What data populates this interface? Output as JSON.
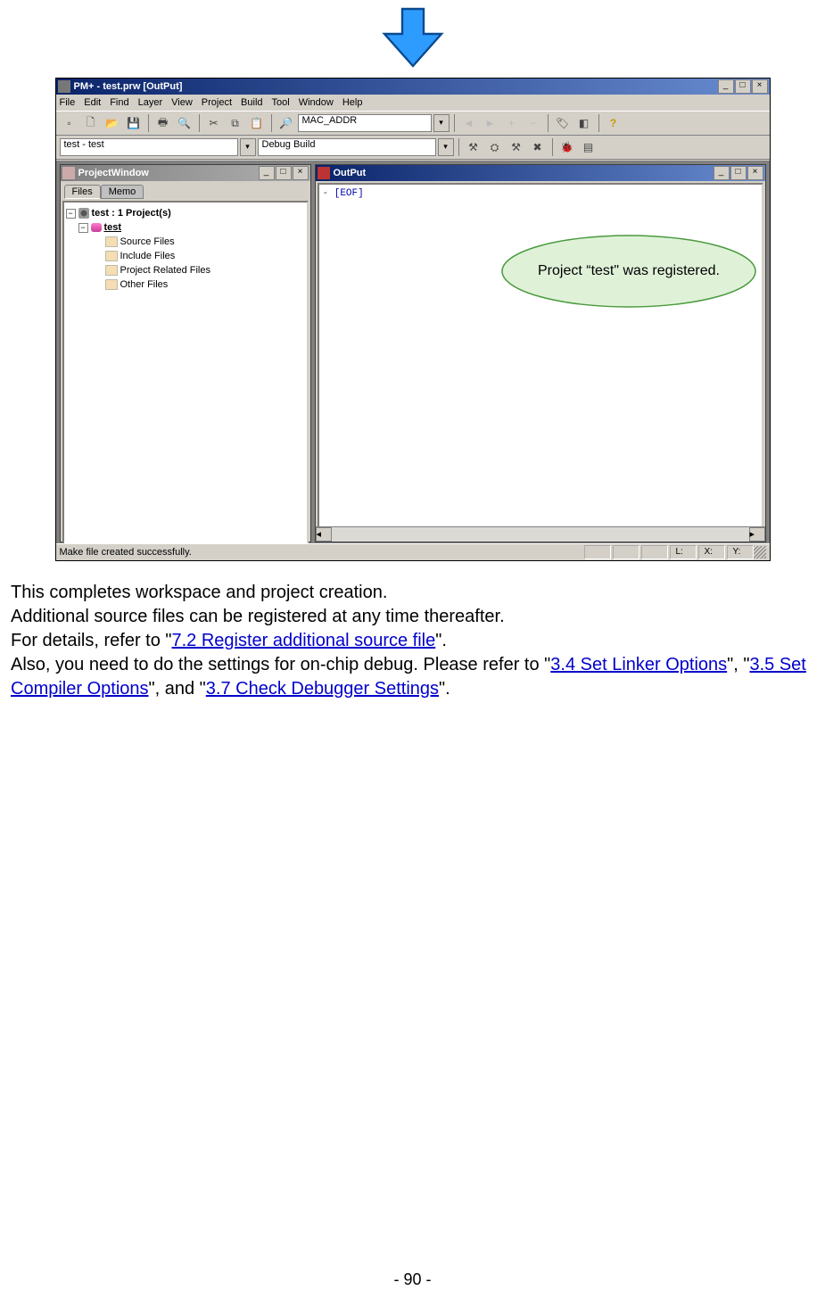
{
  "window": {
    "title": "PM+ - test.prw [OutPut]",
    "menus": [
      "File",
      "Edit",
      "Find",
      "Layer",
      "View",
      "Project",
      "Build",
      "Tool",
      "Window",
      "Help"
    ],
    "toolbar_combo1": "MAC_ADDR",
    "project_selector": "test - test",
    "build_selector": "Debug Build"
  },
  "project_window": {
    "title": "ProjectWindow",
    "tab_files": "Files",
    "tab_memo": "Memo",
    "root": "test : 1 Project(s)",
    "project": "test",
    "folders": [
      "Source Files",
      "Include Files",
      "Project Related Files",
      "Other Files"
    ]
  },
  "output_window": {
    "title": "OutPut",
    "content_dash": "-",
    "content_eof": "[EOF]"
  },
  "statusbar": {
    "message": "Make file created successfully.",
    "L": "L:",
    "X": "X:",
    "Y": "Y:"
  },
  "callout": "Project “test\" was registered.",
  "body": {
    "p1": "This completes workspace and project creation.",
    "p2": "Additional source files can be registered at any time thereafter.",
    "p3a": "For details, refer to \"",
    "p3link": "7.2 Register additional source file",
    "p3b": "\".",
    "p4a": "Also, you need to do the settings for on-chip debug. Please refer to \"",
    "p4link1": "3.4 Set Linker Options",
    "p4b": "\", \"",
    "p4link2": "3.5 Set Compiler Options",
    "p4c": "\", and \"",
    "p4link3": "3.7 Check Debugger Settings",
    "p4d": "\"."
  },
  "page_number": "- 90 -"
}
